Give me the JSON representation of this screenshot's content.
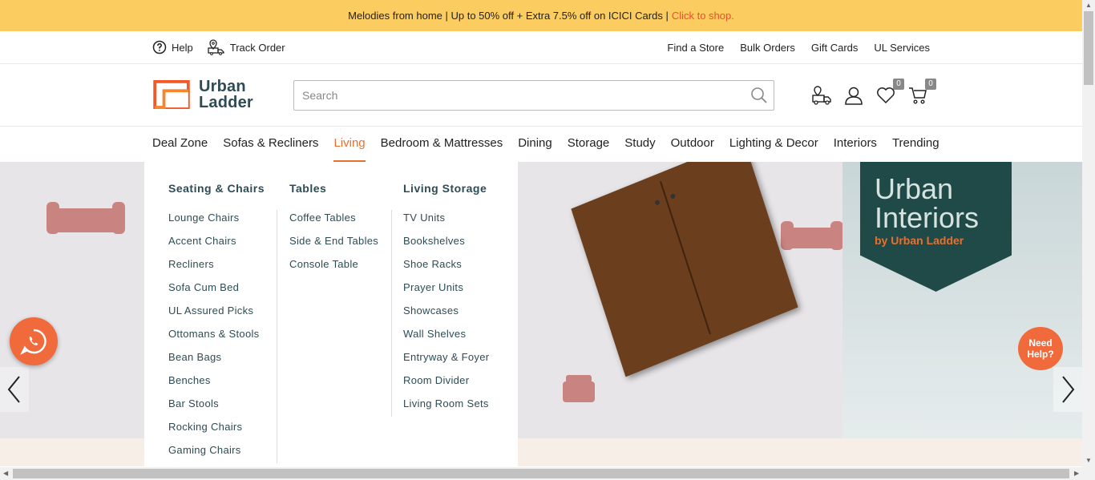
{
  "promo": {
    "text": "Melodies from home | Up to 50% off + Extra 7.5% off on ICICI Cards |",
    "cta": "Click to shop."
  },
  "utility": {
    "help": "Help",
    "track": "Track Order",
    "links": [
      "Find a Store",
      "Bulk Orders",
      "Gift Cards",
      "UL Services"
    ]
  },
  "header": {
    "brand_line1": "Urban",
    "brand_line2": "Ladder",
    "search_placeholder": "Search",
    "wishlist_count": "0",
    "cart_count": "0"
  },
  "nav": [
    "Deal Zone",
    "Sofas & Recliners",
    "Living",
    "Bedroom & Mattresses",
    "Dining",
    "Storage",
    "Study",
    "Outdoor",
    "Lighting & Decor",
    "Interiors",
    "Trending"
  ],
  "nav_active": "Living",
  "mega": {
    "seating": {
      "title": "Seating & Chairs",
      "items": [
        "Lounge Chairs",
        "Accent Chairs",
        "Recliners",
        "Sofa Cum Bed",
        "UL Assured Picks",
        "Ottomans & Stools",
        "Bean Bags",
        "Benches",
        "Bar Stools",
        "Rocking Chairs",
        "Gaming Chairs"
      ]
    },
    "tables": {
      "title": "Tables",
      "items": [
        "Coffee Tables",
        "Side & End Tables",
        "Console Table"
      ]
    },
    "storage": {
      "title": "Living Storage",
      "items": [
        "TV Units",
        "Bookshelves",
        "Shoe Racks",
        "Prayer Units",
        "Showcases",
        "Wall Shelves",
        "Entryway & Foyer",
        "Room Divider",
        "Living Room Sets"
      ]
    }
  },
  "banner": {
    "line1": "Urban",
    "line2": "Interiors",
    "line3": "by Urban Ladder"
  },
  "help_bubble": {
    "line1": "Need",
    "line2": "Help?"
  },
  "colors": {
    "accent": "#e8702f",
    "promo_bg": "#fbcc60",
    "brand_text": "#2d4c55"
  }
}
